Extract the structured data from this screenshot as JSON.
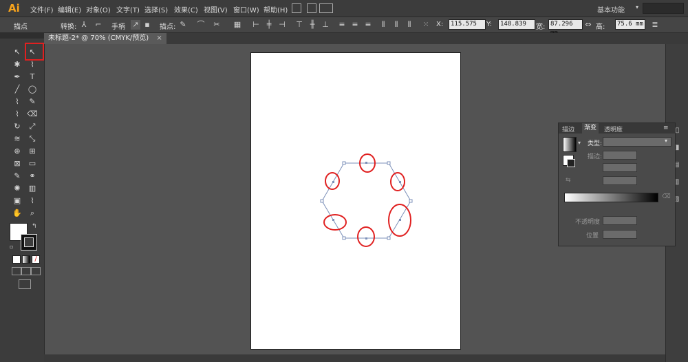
{
  "app": {
    "logo": "Ai"
  },
  "menu": [
    "文件(F)",
    "编辑(E)",
    "对象(O)",
    "文字(T)",
    "选择(S)",
    "效果(C)",
    "视图(V)",
    "窗口(W)",
    "帮助(H)"
  ],
  "workspace": {
    "label": "基本功能"
  },
  "control": {
    "anchor_label": "描点",
    "convert_label": "转换:",
    "handle_label": "手柄",
    "anchor2_label": "描点:",
    "x_label": "X:",
    "x_value": "115.575",
    "y_label": "Y:",
    "y_value": "148.839",
    "w_label": "宽:",
    "w_value": "87.296 mm",
    "h_label": "高:",
    "h_value": "75.6 mm"
  },
  "document": {
    "tab_label": "未标题-2* @ 70% (CMYK/预览)",
    "close": "×"
  },
  "gradient_panel": {
    "tabs": [
      "描边",
      "渐变",
      "透明度"
    ],
    "active_tab": "渐变",
    "type_label": "类型:",
    "stroke_label": "描边:",
    "opacity_label": "不透明度",
    "location_label": "位置"
  },
  "tools": [
    "selection-tool",
    "direct-selection-tool",
    "magic-wand-tool",
    "lasso-tool",
    "pen-tool",
    "type-tool",
    "line-tool",
    "ellipse-tool",
    "paintbrush-tool",
    "pencil-tool",
    "blob-brush-tool",
    "eraser-tool",
    "rotate-tool",
    "scale-tool",
    "width-tool",
    "free-transform-tool",
    "shape-builder-tool",
    "perspective-grid-tool",
    "mesh-tool",
    "gradient-tool",
    "eyedropper-tool",
    "blend-tool",
    "symbol-sprayer-tool",
    "column-graph-tool",
    "artboard-tool",
    "slice-tool",
    "hand-tool",
    "zoom-tool"
  ],
  "colors": {
    "highlight": "#e02020",
    "path": "#7b8fb8",
    "ui_dark": "#3c3c3c",
    "canvas": "#535353"
  }
}
